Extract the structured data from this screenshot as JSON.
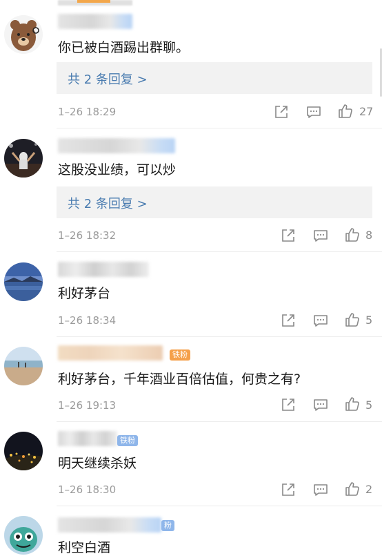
{
  "comments": [
    {
      "text": "你已被白酒踢出群聊。",
      "reply_label": "共 2 条回复 >",
      "time": "1–26 18:29",
      "likes": "27",
      "avatar": "brown-bear-avatar"
    },
    {
      "text": "这股没业绩，可以炒",
      "reply_label": "共 2 条回复 >",
      "time": "1–26 18:32",
      "likes": "8",
      "avatar": "basketball-player-avatar"
    },
    {
      "text": "利好茅台",
      "time": "1–26 18:34",
      "likes": "5",
      "avatar": "lake-landscape-avatar"
    },
    {
      "text": "利好茅台，千年酒业百倍估值，何贵之有?",
      "badge": "铁粉",
      "time": "1–26 19:13",
      "likes": "5",
      "avatar": "beach-avatar"
    },
    {
      "text": "明天继续杀妖",
      "badge": "铁粉",
      "time": "1–26 18:30",
      "likes": "2",
      "avatar": "night-city-avatar"
    },
    {
      "text": "利空白酒",
      "badge": "粉",
      "avatar": "green-monster-avatar"
    }
  ],
  "icons": {
    "share": "share-icon",
    "comment": "comment-icon",
    "like": "thumbs-up-icon"
  }
}
